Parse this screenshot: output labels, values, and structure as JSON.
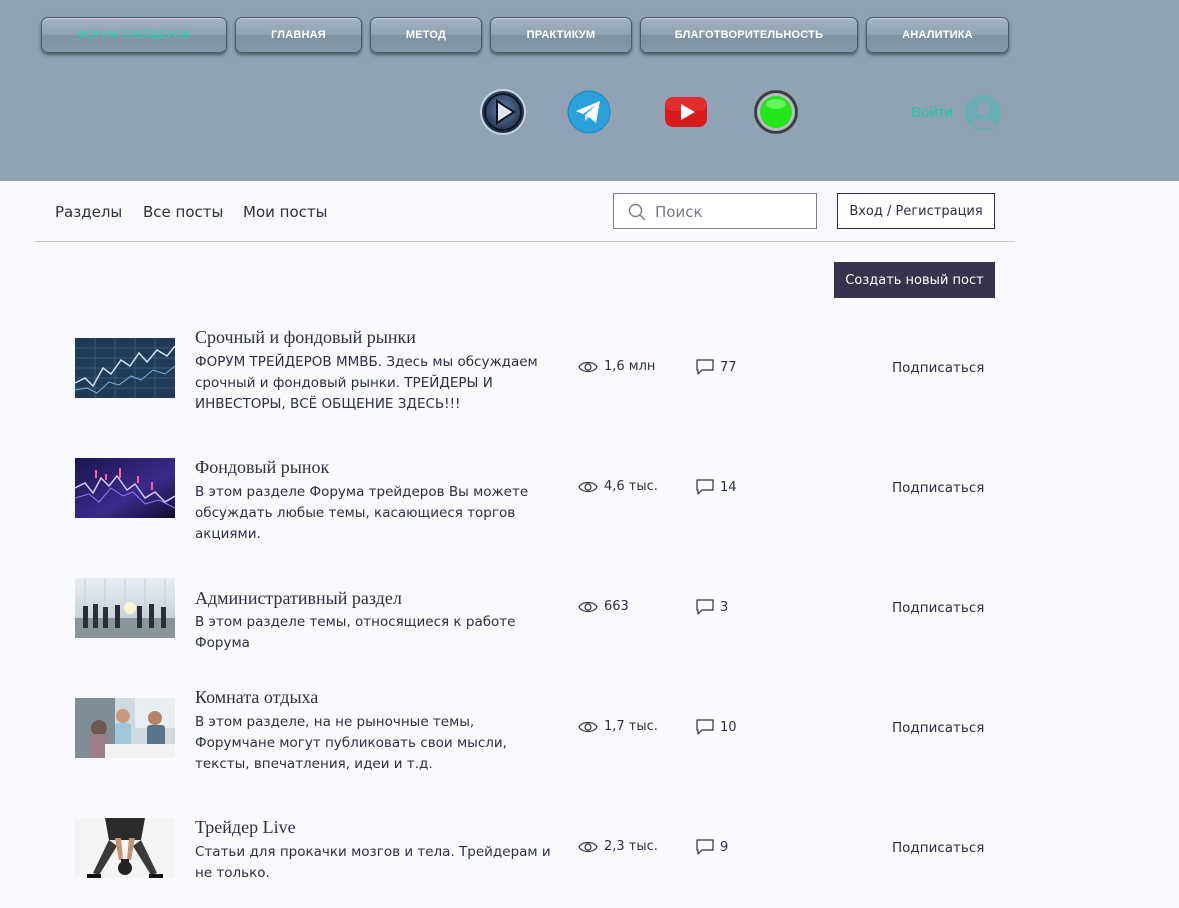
{
  "nav": {
    "items": [
      {
        "label": "ФОРУМ ТРЕЙДЕРОВ"
      },
      {
        "label": "ГЛАВНАЯ"
      },
      {
        "label": "МЕТОД"
      },
      {
        "label": "ПРАКТИКУМ"
      },
      {
        "label": "БЛАГОТВОРИТЕЛЬНОСТЬ"
      },
      {
        "label": "АНАЛИТИКА"
      }
    ],
    "active_color": "#1dd8b4"
  },
  "social": {
    "icons": [
      "video-play-icon",
      "telegram-icon",
      "youtube-icon",
      "green-button-icon"
    ]
  },
  "account": {
    "login_label": "Войти",
    "avatar_icon": "user-avatar-icon"
  },
  "forum_tabs": {
    "sections": "Разделы",
    "all_posts": "Все посты",
    "my_posts": "Мои посты"
  },
  "search": {
    "placeholder": "Поиск"
  },
  "auth": {
    "login_register": "Вход / Регистрация"
  },
  "create_post": {
    "label": "Создать новый пост"
  },
  "categories": [
    {
      "title": "Срочный и фондовый рынки",
      "description": "ФОРУМ ТРЕЙДЕРОВ ММВБ. Здесь мы обсуждаем срочный и фондовый рынки. ТРЕЙДЕРЫ И ИНВЕСТОРЫ, ВСЁ ОБЩЕНИЕ ЗДЕСЬ!!!",
      "views": "1,6 млн",
      "comments": "77",
      "subscribe": "Подписаться",
      "thumb": "stock-chart-image"
    },
    {
      "title": "Фондовый рынок",
      "description": "В этом разделе Форума трейдеров Вы можете обсуждать любые темы, касающиеся торгов акциями.",
      "views": "4,6 тыс.",
      "comments": "14",
      "subscribe": "Подписаться",
      "thumb": "purple-chart-image"
    },
    {
      "title": "Административный раздел",
      "description": "В этом разделе темы, относящиеся к работе Форума",
      "views": "663",
      "comments": "3",
      "subscribe": "Подписаться",
      "thumb": "office-people-image"
    },
    {
      "title": "Комната отдыха",
      "description": "В этом разделе, на не рыночные темы, Форумчане могут публиковать свои мысли, тексты, впечатления, идеи и т.д.",
      "views": "1,7 тыс.",
      "comments": "10",
      "subscribe": "Подписаться",
      "thumb": "people-relaxing-image"
    },
    {
      "title": "Трейдер Live",
      "description": "Статьи для прокачки мозгов и тела. Трейдерам и не только.",
      "views": "2,3 тыс.",
      "comments": "9",
      "subscribe": "Подписаться",
      "thumb": "kettlebell-image"
    }
  ],
  "colors": {
    "header_bg": "#8fa3b5",
    "page_bg": "#f9fafd",
    "accent": "#1ec9a9",
    "dark_button": "#39324f",
    "text": "#2f2e45"
  }
}
